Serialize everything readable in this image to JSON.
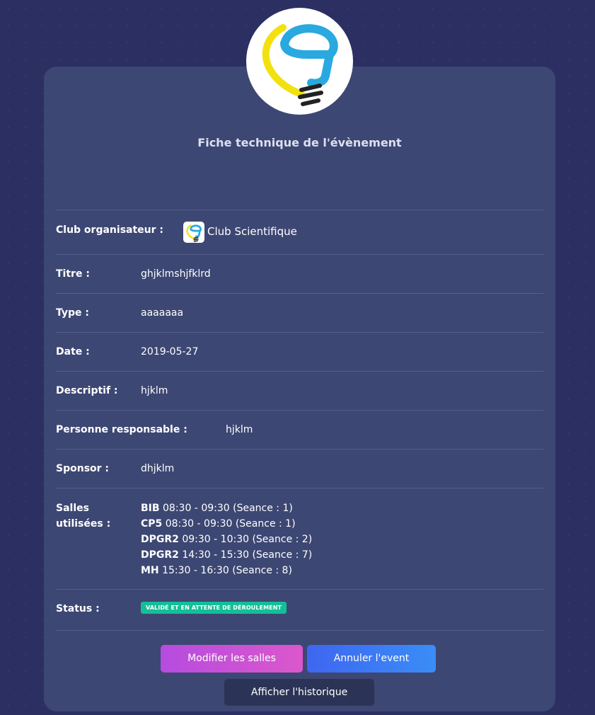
{
  "page": {
    "title": "Fiche technique de l'évènement"
  },
  "fields": {
    "club": {
      "label": "Club organisateur :",
      "value": "Club Scientifique"
    },
    "titre": {
      "label": "Titre :",
      "value": "ghjklmshjfklrd"
    },
    "type": {
      "label": "Type :",
      "value": "aaaaaaa"
    },
    "date": {
      "label": "Date :",
      "value": "2019-05-27"
    },
    "descriptif": {
      "label": "Descriptif :",
      "value": "hjklm"
    },
    "responsable": {
      "label": "Personne responsable :",
      "value": "hjklm"
    },
    "sponsor": {
      "label": "Sponsor :",
      "value": "dhjklm"
    },
    "salles": {
      "label_line1": "Salles",
      "label_line2": "utilisées :",
      "items": [
        {
          "room": "BIB",
          "time": "08:30 - 09:30 (Seance : 1)"
        },
        {
          "room": "CP5",
          "time": "08:30 - 09:30 (Seance : 1)"
        },
        {
          "room": "DPGR2",
          "time": "09:30 - 10:30 (Seance : 2)"
        },
        {
          "room": "DPGR2",
          "time": "14:30 - 15:30 (Seance : 7)"
        },
        {
          "room": "MH",
          "time": "15:30 - 16:30 (Seance : 8)"
        }
      ]
    },
    "status": {
      "label": "Status :",
      "value": "VALIDÉ ET EN ATTENTE DE DÉROULEMENT"
    }
  },
  "buttons": {
    "modify_rooms": "Modifier les salles",
    "cancel_event": "Annuler l'event",
    "show_history": "Afficher l'historique"
  },
  "colors": {
    "background": "#2b2f62",
    "card": "#3d4773",
    "badge": "#14bf98",
    "btn_rooms": "#c750d6",
    "btn_cancel": "#3c78f3",
    "btn_history": "#2b3457",
    "logo_blue": "#29a9e0",
    "logo_yellow": "#f2e10f"
  },
  "icons": {
    "logo": "lightbulb-logo-icon",
    "club": "lightbulb-logo-icon"
  }
}
